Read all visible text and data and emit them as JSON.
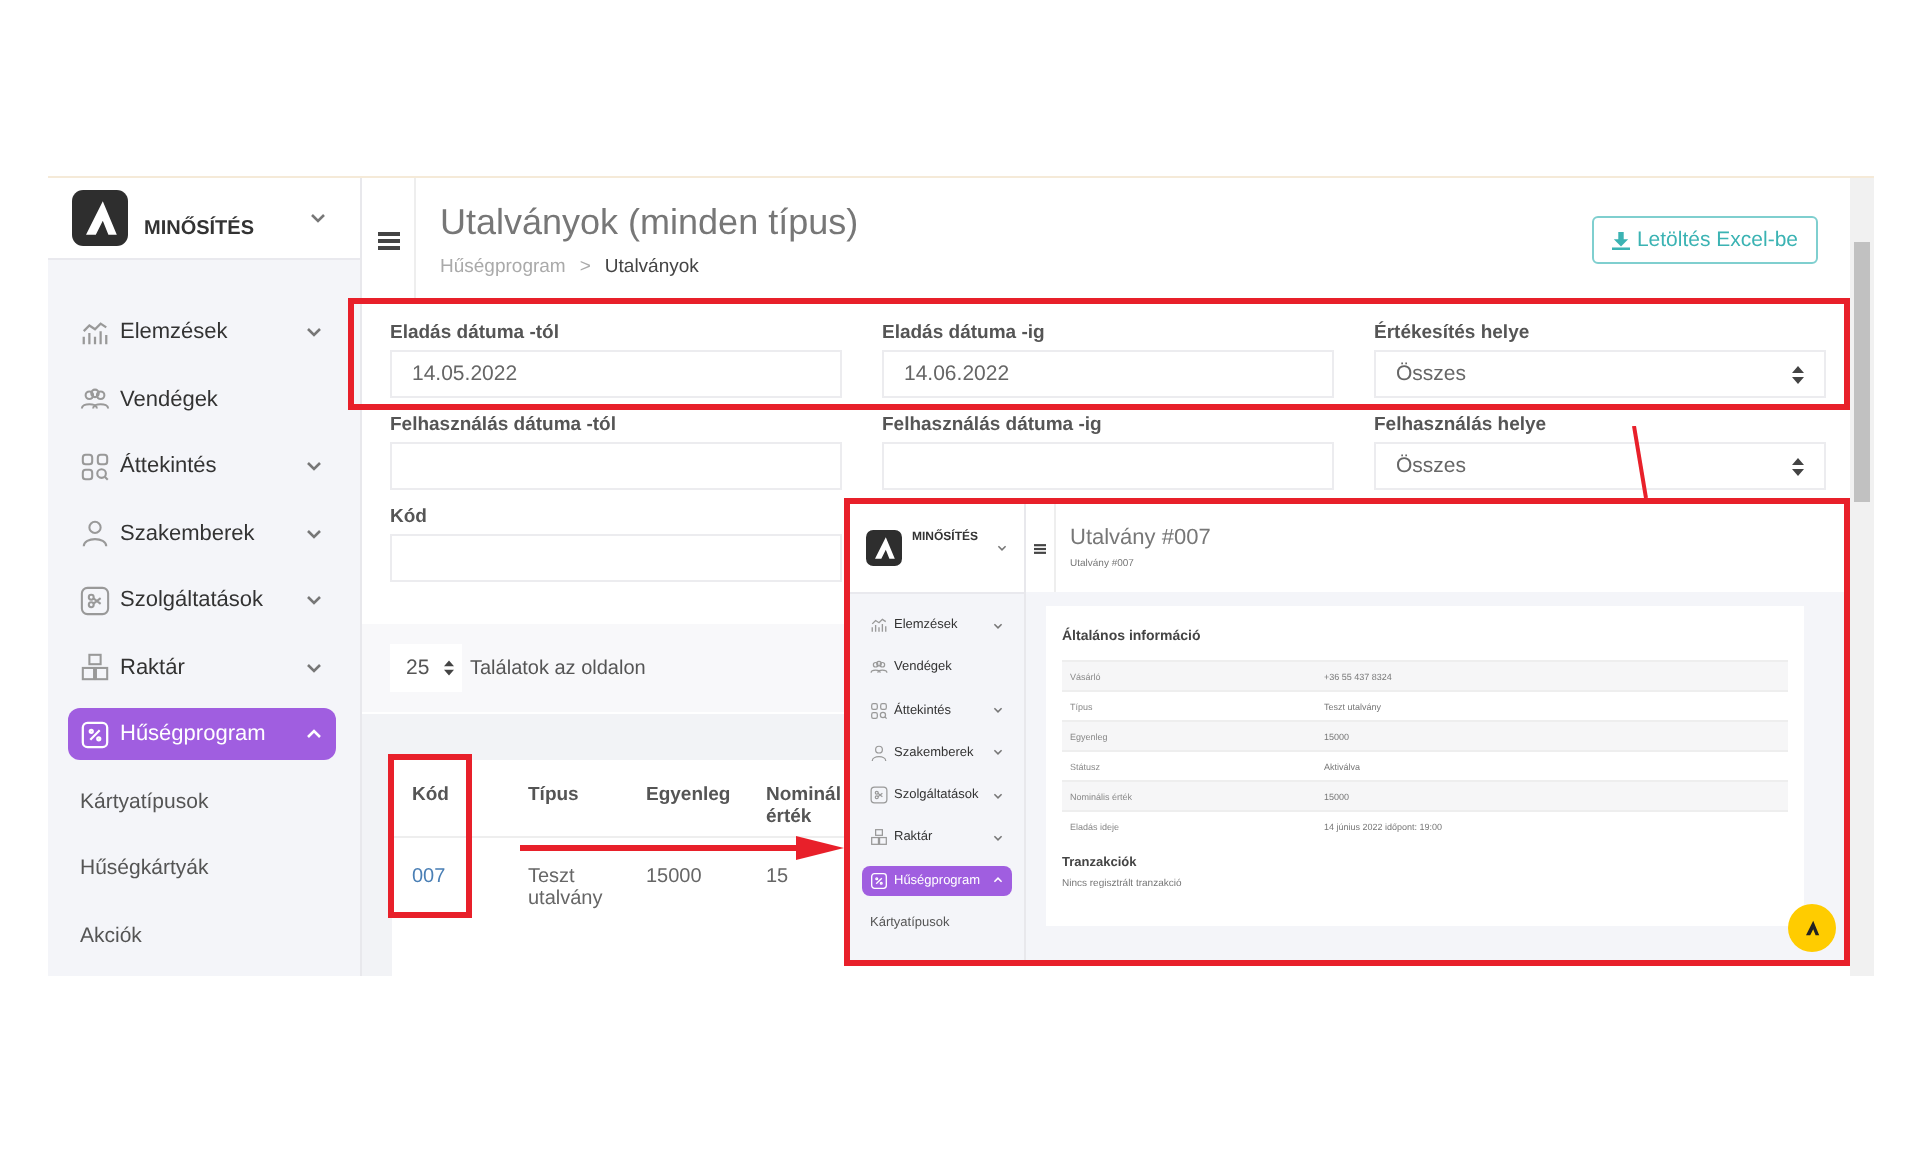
{
  "sidebar": {
    "brand": "MINŐSÍTÉS",
    "items": [
      {
        "label": "Elemzések",
        "expanded": false,
        "selected": false
      },
      {
        "label": "Vendégek",
        "selected": false
      },
      {
        "label": "Áttekintés",
        "expanded": false,
        "selected": false
      },
      {
        "label": "Szakemberek",
        "expanded": false,
        "selected": false
      },
      {
        "label": "Szolgáltatások",
        "expanded": false,
        "selected": false
      },
      {
        "label": "Raktár",
        "expanded": false,
        "selected": false
      },
      {
        "label": "Hűségprogram",
        "expanded": true,
        "selected": true,
        "children": [
          {
            "label": "Kártyatípusok"
          },
          {
            "label": "Hűségkártyák"
          },
          {
            "label": "Akciók"
          }
        ]
      }
    ]
  },
  "header": {
    "title": "Utalványok (minden típus)",
    "breadcrumb": [
      "Hűségprogram",
      "Utalványok"
    ],
    "breadcrumb_separator": ">",
    "export_button": "Letöltés Excel-be"
  },
  "filters": [
    {
      "label": "Eladás dátuma -tól",
      "kind": "input",
      "value": "14.05.2022"
    },
    {
      "label": "Eladás dátuma -ig",
      "kind": "input",
      "value": "14.06.2022"
    },
    {
      "label": "Értékesítés helye",
      "kind": "select",
      "value": "Összes"
    },
    {
      "label": "Felhasználás dátuma -tól",
      "kind": "input"
    },
    {
      "label": "Felhasználás dátuma -ig",
      "kind": "input"
    },
    {
      "label": "Felhasználás helye",
      "kind": "select",
      "value": "Összes"
    },
    {
      "label": "Kód",
      "kind": "input"
    }
  ],
  "page_size": {
    "value": "25",
    "label": "Találatok az oldalon"
  },
  "table": {
    "columns": [
      "Kód",
      "Típus",
      "Egyenleg",
      "Nominál érték"
    ],
    "rows": [
      [
        "007",
        "Teszt utalvány",
        "15000",
        "15"
      ]
    ]
  },
  "inset": {
    "sidebar": {
      "brand": "MINŐSÍTÉS",
      "items": [
        {
          "label": "Elemzések",
          "expanded": false,
          "selected": false
        },
        {
          "label": "Vendégek",
          "selected": false
        },
        {
          "label": "Áttekintés",
          "expanded": false,
          "selected": false
        },
        {
          "label": "Szakemberek",
          "expanded": false,
          "selected": false
        },
        {
          "label": "Szolgáltatások",
          "expanded": false,
          "selected": false
        },
        {
          "label": "Raktár",
          "expanded": false,
          "selected": false
        },
        {
          "label": "Hűségprogram",
          "expanded": true,
          "selected": true,
          "children": [
            {
              "label": "Kártyatípusok"
            }
          ]
        }
      ]
    },
    "title": "Utalvány #007",
    "breadcrumb": "Utalvány #007",
    "section": "Általános információ",
    "rows": [
      {
        "label": "Vásárló",
        "value": "+36 55 437 8324"
      },
      {
        "label": "Típus",
        "value": "Teszt utalvány"
      },
      {
        "label": "Egyenleg",
        "value": "15000"
      },
      {
        "label": "Státusz",
        "value": "Aktiválva"
      },
      {
        "label": "Nominális érték",
        "value": "15000"
      },
      {
        "label": "Eladás ideje",
        "value": "14 június 2022 időpont: 19:00"
      }
    ],
    "transactions_title": "Tranzakciók",
    "transactions_empty": "Nincs regisztrált tranzakció"
  }
}
